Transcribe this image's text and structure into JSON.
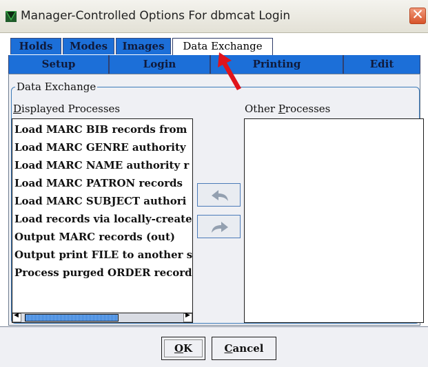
{
  "window": {
    "title": "Manager-Controlled Options For dbmcat Login",
    "close_symbol": "✕"
  },
  "tabs_row1": [
    {
      "label": "Holds",
      "active": false
    },
    {
      "label": "Modes",
      "active": false
    },
    {
      "label": "Images",
      "active": false
    },
    {
      "label": "Data Exchange",
      "active": true
    }
  ],
  "tabs_row2": [
    {
      "label": "Setup"
    },
    {
      "label": "Login"
    },
    {
      "label": "Printing"
    },
    {
      "label": "Edit"
    }
  ],
  "group": {
    "legend": "Data Exchange",
    "displayed_label_u": "D",
    "displayed_label_rest": "isplayed Processes",
    "other_label_a": "Other ",
    "other_label_u": "P",
    "other_label_b": "rocesses"
  },
  "displayed_processes": [
    "Load MARC BIB records from",
    "Load MARC GENRE authority",
    "Load MARC NAME authority r",
    "Load MARC PATRON records",
    "Load MARC SUBJECT authori",
    "Load records via locally-create",
    "Output MARC records (out)",
    "Output print FILE to another s",
    "Process purged ORDER record"
  ],
  "other_processes": [],
  "scrollbar": {
    "left_arrow": "◀",
    "right_arrow": "▶"
  },
  "buttons": {
    "ok_u": "O",
    "ok_rest": "K",
    "cancel_u": "C",
    "cancel_rest": "ancel"
  },
  "icons": {
    "app": "app-window-icon",
    "move_left": "move-left-arrow-icon",
    "move_right": "move-right-arrow-icon",
    "annotation": "red-pointer-arrow-icon"
  },
  "colors": {
    "tab_blue": "#1c6fd8",
    "panel_bg": "#eff0f4",
    "close_red": "#d7532a",
    "annotation_red": "#e0141b"
  }
}
